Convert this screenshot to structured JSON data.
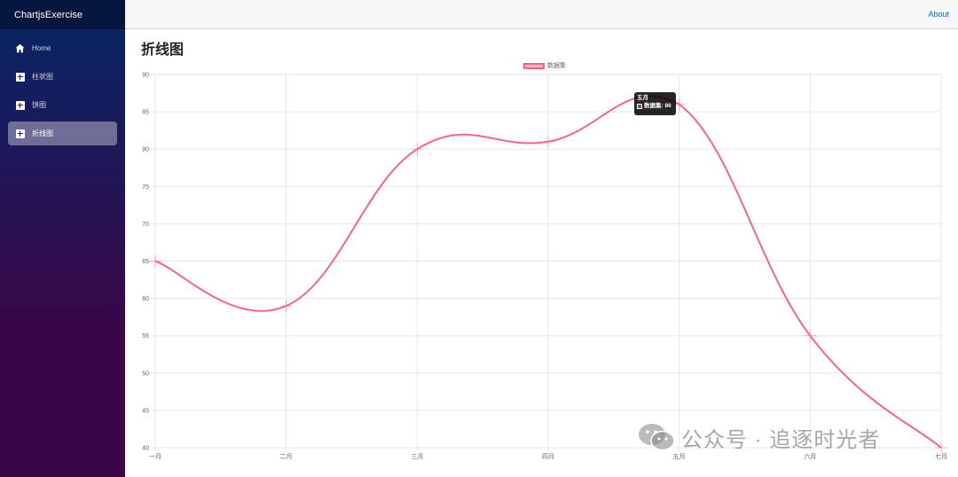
{
  "sidebar": {
    "brand": "ChartjsExercise",
    "items": [
      {
        "label": "Home",
        "icon": "home-icon",
        "active": false
      },
      {
        "label": "柱状图",
        "icon": "plus-square-icon",
        "active": false
      },
      {
        "label": "饼图",
        "icon": "plus-square-icon",
        "active": false
      },
      {
        "label": "折线图",
        "icon": "plus-square-icon",
        "active": true
      }
    ]
  },
  "top_row": {
    "about": "About"
  },
  "page": {
    "title": "折线图"
  },
  "tooltip": {
    "title": "五月",
    "label": "数据集: 86"
  },
  "watermark": {
    "text": "公众号 · 追逐时光者"
  },
  "colors": {
    "line": "#ff6384",
    "legend_fill": "rgba(255,99,132,0.5)",
    "grid": "#e6e6e6",
    "sidebar_top": "#052767",
    "sidebar_bottom": "#3a0647"
  },
  "chart_data": {
    "type": "line",
    "categories": [
      "一月",
      "二月",
      "三月",
      "四月",
      "五月",
      "六月",
      "七月"
    ],
    "series": [
      {
        "name": "数据集",
        "values": [
          65,
          59,
          80,
          81,
          86,
          55,
          40
        ]
      }
    ],
    "ylim": [
      40,
      90
    ],
    "yticks": [
      40,
      45,
      50,
      55,
      60,
      65,
      70,
      75,
      80,
      85,
      90
    ],
    "grid": true,
    "legend": "top-center"
  }
}
